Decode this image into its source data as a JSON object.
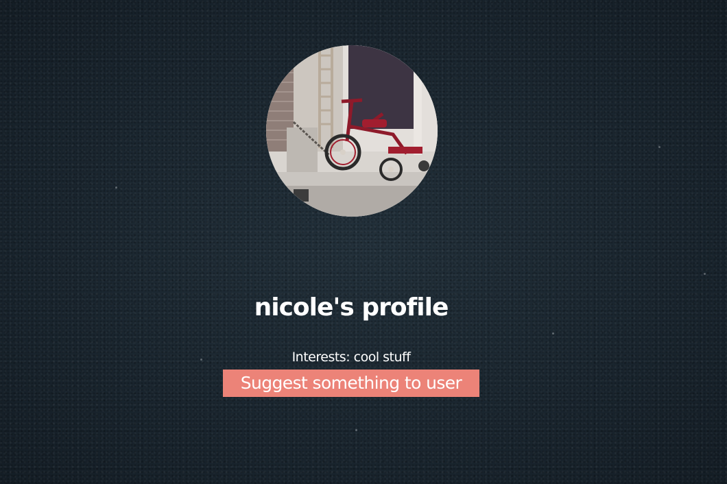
{
  "profile": {
    "avatar": {
      "icon": "tricycle-photo",
      "alt": "Red tricycle chained beside a building"
    },
    "title": "nicole's profile",
    "interests_text": "Interests: cool stuff"
  },
  "actions": {
    "suggest_label": "Suggest something to user"
  },
  "colors": {
    "background": "#1b2731",
    "button": "#ec8378",
    "text": "#ffffff"
  }
}
